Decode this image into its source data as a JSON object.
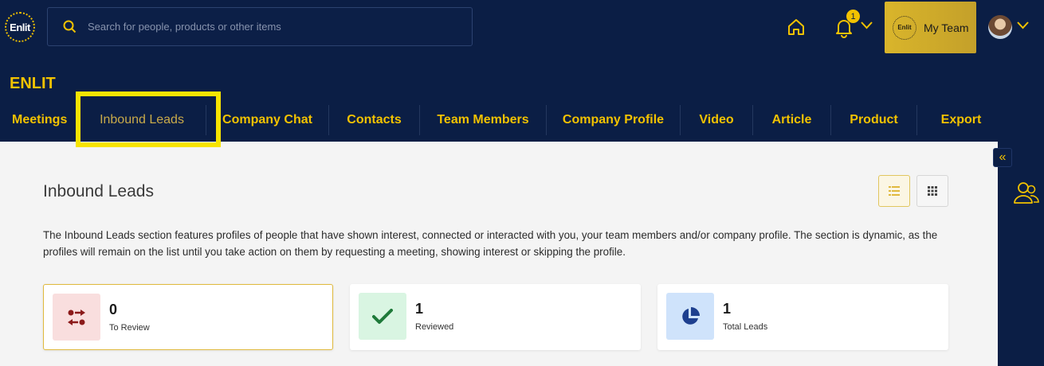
{
  "header": {
    "logo_text": "Enlit",
    "search_placeholder": "Search for people, products or other items",
    "notification_count": "1",
    "team_logo_text": "Enlit",
    "team_button_label": "My Team"
  },
  "brand": "ENLIT",
  "nav": {
    "items": [
      "Meetings",
      "Inbound Leads",
      "Company Chat",
      "Contacts",
      "Team Members",
      "Company Profile",
      "Video",
      "Article",
      "Product",
      "Export"
    ],
    "active": "Inbound Leads"
  },
  "page": {
    "title": "Inbound Leads",
    "description": "The Inbound Leads section features profiles of people that have shown interest, connected or interacted with you, your team members and/or company profile. The section is dynamic, as the profiles will remain on the list until you take action on them by requesting a meeting, showing interest or skipping the profile."
  },
  "stats": [
    {
      "value": "0",
      "label": "To Review",
      "icon": "swap-arrows-icon",
      "color": "#8b1a1a",
      "bg": "#f9dede"
    },
    {
      "value": "1",
      "label": "Reviewed",
      "icon": "check-icon",
      "color": "#1f7a3a",
      "bg": "#d9f5e2"
    },
    {
      "value": "1",
      "label": "Total Leads",
      "icon": "pie-chart-icon",
      "color": "#1d3f8f",
      "bg": "#cfe3fb"
    }
  ],
  "colors": {
    "navy": "#0b1e45",
    "accent": "#f2c200",
    "highlight": "#f7e400"
  }
}
